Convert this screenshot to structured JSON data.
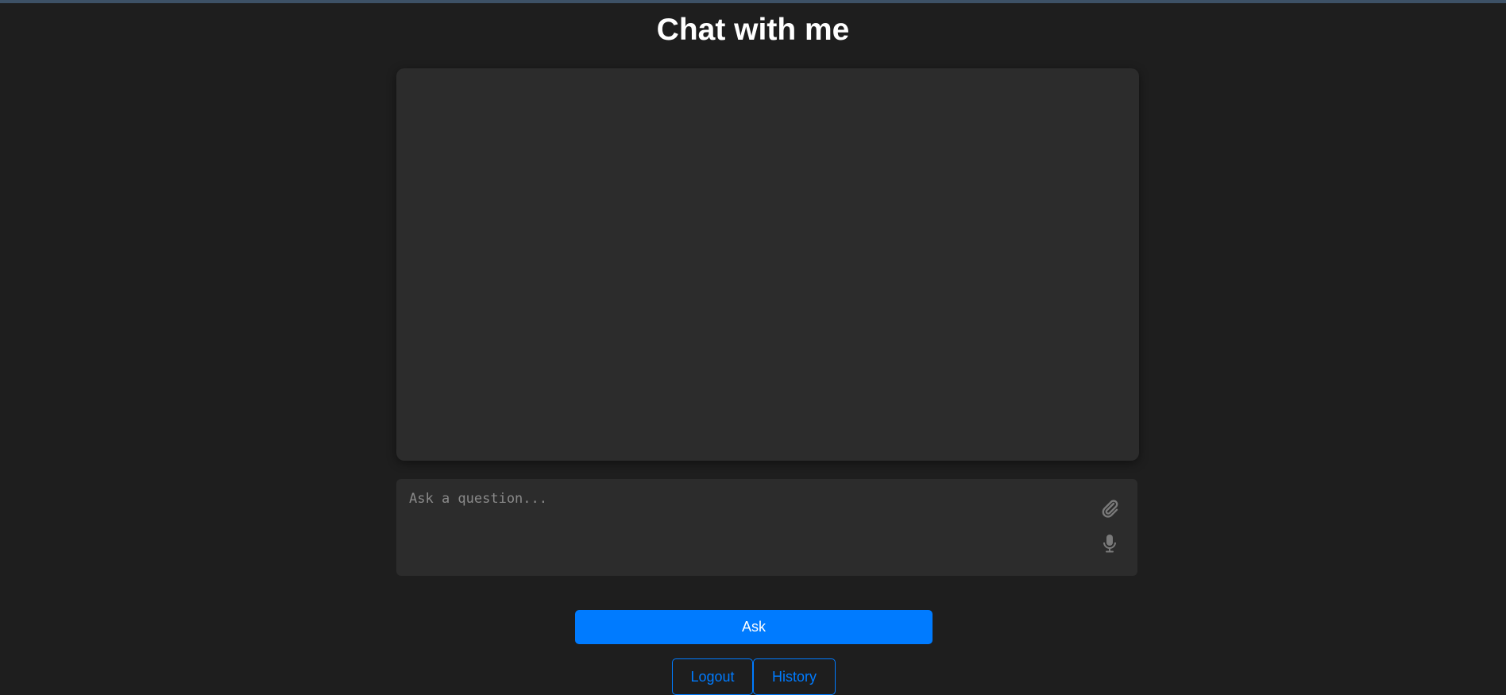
{
  "header": {
    "title": "Chat with me"
  },
  "chat": {
    "messages": []
  },
  "composer": {
    "placeholder": "Ask a question...",
    "value": "",
    "attach_icon": "paperclip-icon",
    "mic_icon": "microphone-icon"
  },
  "actions": {
    "ask_label": "Ask",
    "logout_label": "Logout",
    "history_label": "History"
  },
  "colors": {
    "background": "#1e1e1e",
    "panel": "#2c2c2c",
    "accent": "#007bff",
    "icon": "#7a7a7a"
  }
}
